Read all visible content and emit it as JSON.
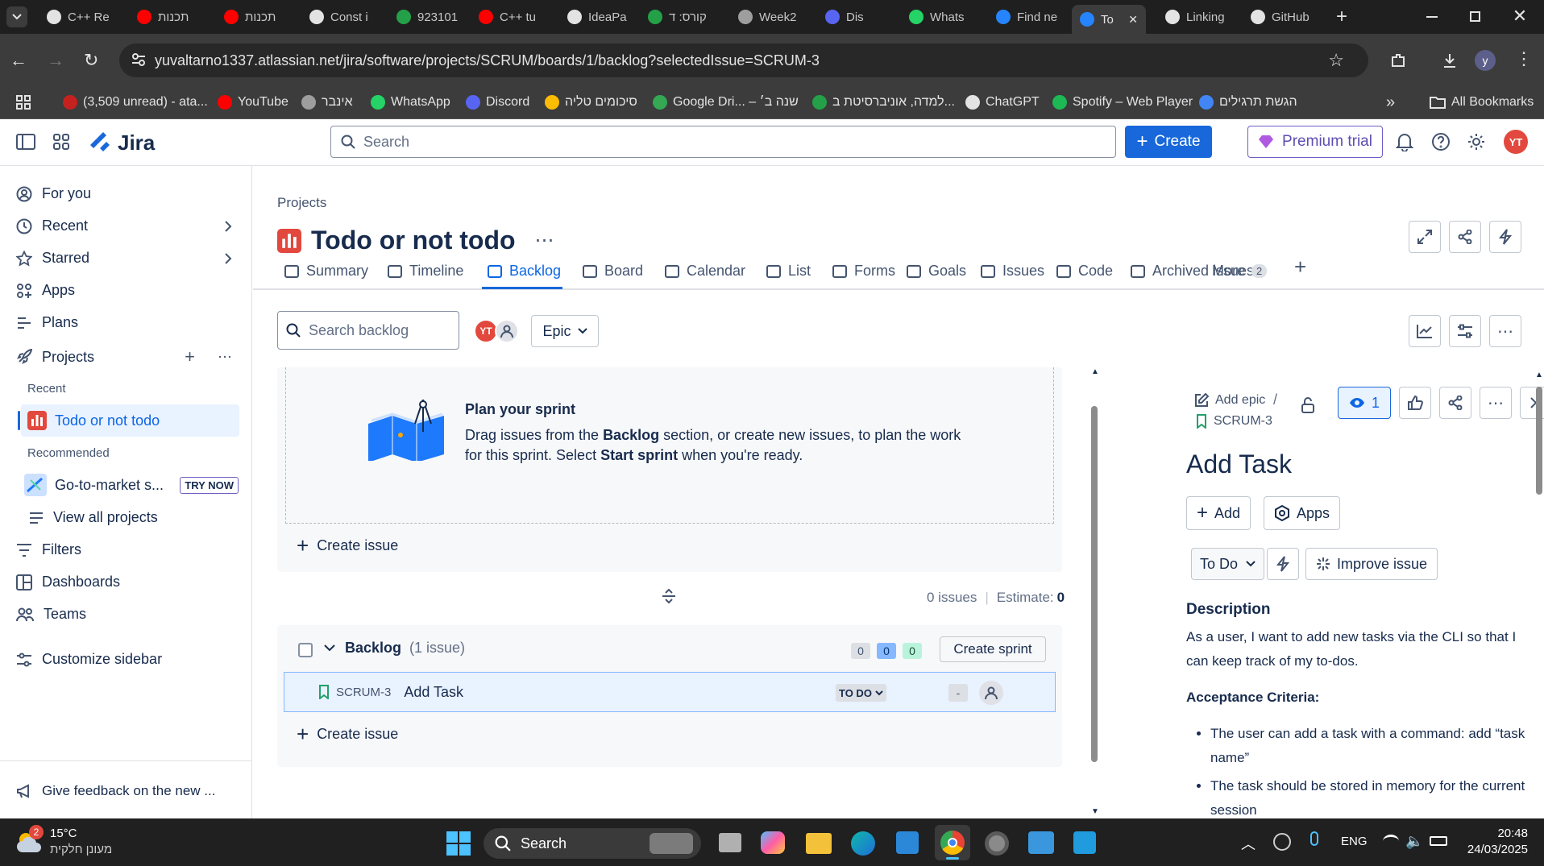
{
  "browser": {
    "tabs": [
      {
        "label": "C++ Re",
        "color": "#e3e3e3"
      },
      {
        "label": "תכנות",
        "color": "#ff0000"
      },
      {
        "label": "תכנות",
        "color": "#ff0000"
      },
      {
        "label": "Const i",
        "color": "#e3e3e3"
      },
      {
        "label": "923101",
        "color": "#24a148"
      },
      {
        "label": "C++ tu",
        "color": "#ff0000"
      },
      {
        "label": "IdeaPa",
        "color": "#e3e3e3"
      },
      {
        "label": "קורס: ד",
        "color": "#24a148"
      },
      {
        "label": "Week2",
        "color": "#9e9e9e"
      },
      {
        "label": "Dis",
        "color": "#5865f2"
      },
      {
        "label": "Whats",
        "color": "#25d366"
      },
      {
        "label": "Find ne",
        "color": "#2684ff"
      },
      {
        "label": "To",
        "color": "#2684ff"
      },
      {
        "label": "Linking",
        "color": "#e3e3e3"
      },
      {
        "label": "GitHub",
        "color": "#e3e3e3"
      }
    ],
    "url": "yuvaltarno1337.atlassian.net/jira/software/projects/SCRUM/boards/1/backlog?selectedIssue=SCRUM-3",
    "profile_initial": "y",
    "bookmarks": [
      {
        "label": "(3,509 unread) - ata...",
        "color": "#c5221f"
      },
      {
        "label": "YouTube",
        "color": "#ff0000"
      },
      {
        "label": "אינבר",
        "color": "#9e9e9e"
      },
      {
        "label": "WhatsApp",
        "color": "#25d366"
      },
      {
        "label": "Discord",
        "color": "#5865f2"
      },
      {
        "label": "סיכומים טליה",
        "color": "#fbbc04"
      },
      {
        "label": "Google Dri... – שנה ב׳",
        "color": "#34a853"
      },
      {
        "label": "למדה, אוניברסיטת ב...",
        "color": "#24a148"
      },
      {
        "label": "ChatGPT",
        "color": "#e3e3e3"
      },
      {
        "label": "Spotify – Web Player",
        "color": "#1db954"
      },
      {
        "label": "הגשת תרגילים",
        "color": "#4285f4"
      }
    ],
    "all_bookmarks": "All Bookmarks"
  },
  "topnav": {
    "product": "Jira",
    "search_placeholder": "Search",
    "create": "Create",
    "premium": "Premium trial",
    "avatar": "YT"
  },
  "sidebar": {
    "items": {
      "for_you": "For you",
      "recent": "Recent",
      "starred": "Starred",
      "apps": "Apps",
      "plans": "Plans",
      "projects": "Projects",
      "filters": "Filters",
      "dashboards": "Dashboards",
      "teams": "Teams",
      "customize": "Customize sidebar"
    },
    "recent_header": "Recent",
    "recent_project": "Todo or not todo",
    "recommended_header": "Recommended",
    "recommended_project": "Go-to-market s...",
    "try_now": "TRY NOW",
    "view_all": "View all projects",
    "feedback": "Give feedback on the new ..."
  },
  "project": {
    "breadcrumb": "Projects",
    "title": "Todo or not todo",
    "tabs": [
      "Summary",
      "Timeline",
      "Backlog",
      "Board",
      "Calendar",
      "List",
      "Forms",
      "Goals",
      "Issues",
      "Code",
      "Archived issues"
    ],
    "more": "More",
    "more_count": "2"
  },
  "backlog_toolbar": {
    "search_placeholder": "Search backlog",
    "avatar": "YT",
    "epic": "Epic"
  },
  "sprint": {
    "title": "Plan your sprint",
    "desc_1": "Drag issues from the ",
    "desc_bold_1": "Backlog",
    "desc_2": " section, or create new issues, to plan the work for this sprint. Select ",
    "desc_bold_2": "Start sprint",
    "desc_3": " when you're ready.",
    "create_issue": "Create issue",
    "issues_count": "0 issues",
    "estimate_label": "Estimate:",
    "estimate_value": "0"
  },
  "backlog": {
    "title": "Backlog",
    "count": "(1 issue)",
    "badges": [
      "0",
      "0",
      "0"
    ],
    "create_sprint": "Create sprint",
    "issue": {
      "key": "SCRUM-3",
      "summary": "Add Task",
      "status": "TO DO",
      "estimate": "-"
    },
    "create_issue": "Create issue"
  },
  "detail": {
    "add_epic": "Add epic",
    "key": "SCRUM-3",
    "watch_count": "1",
    "title": "Add Task",
    "add": "Add",
    "apps": "Apps",
    "status": "To Do",
    "improve": "Improve issue",
    "description_header": "Description",
    "description": "As a user, I want to add new tasks via the CLI so that I can keep track of my to-dos.",
    "acceptance_header": "Acceptance Criteria:",
    "criteria": [
      "The user can add a task with a command: add “task name”",
      "The task should be stored in memory for the current session"
    ]
  },
  "taskbar": {
    "weather_temp": "15°C",
    "weather_desc": "מעונן חלקית",
    "weather_badge": "2",
    "search": "Search",
    "lang": "ENG",
    "time": "20:48",
    "date": "24/03/2025"
  }
}
